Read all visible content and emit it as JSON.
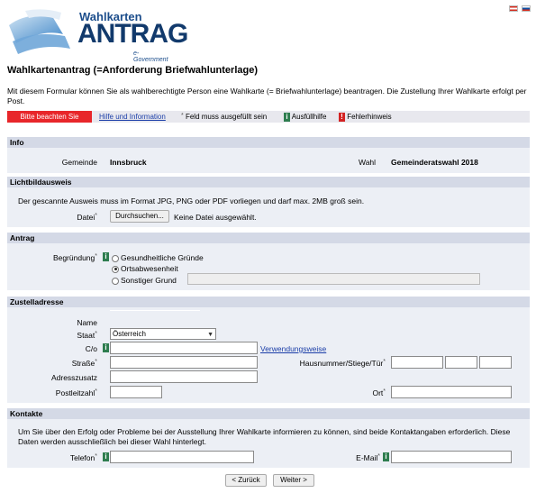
{
  "header": {
    "logo": {
      "line1": "Wahlkarten",
      "line2": "ANTRAG",
      "line3": "e-Government"
    },
    "languages": [
      {
        "name": "austria-flag"
      },
      {
        "name": "slovenia-flag"
      }
    ]
  },
  "page": {
    "title": "Wahlkartenantrag (=Anforderung Briefwahlunterlage)",
    "intro": "Mit diesem Formular können Sie als wahlberechtigte Person eine Wahlkarte (= Briefwahlunterlage) beantragen. Die Zustellung Ihrer Wahlkarte erfolgt per Post."
  },
  "helpbar": {
    "notice_button": "Bitte beachten Sie",
    "help_link": "Hilfe und Information",
    "required_legend": "Feld muss ausgefüllt sein",
    "fill_help_legend": "Ausfüllhilfe",
    "error_legend": "Fehlerhinweis",
    "required_mark": "*",
    "info_mark": "i",
    "error_mark": "!"
  },
  "info": {
    "heading": "Info",
    "gemeinde_label": "Gemeinde",
    "gemeinde_value": "Innsbruck",
    "wahl_label": "Wahl",
    "wahl_value": "Gemeinderatswahl 2018"
  },
  "photo_id": {
    "heading": "Lichtbildausweis",
    "description": "Der gescannte Ausweis muss im Format JPG, PNG oder PDF vorliegen und darf max. 2MB groß sein.",
    "file_label": "Datei",
    "browse_button": "Durchsuchen...",
    "no_file": "Keine Datei ausgewählt."
  },
  "application": {
    "heading": "Antrag",
    "reason_label": "Begründung",
    "options": [
      "Gesundheitliche Gründe",
      "Ortsabwesenheit",
      "Sonstiger Grund"
    ],
    "selected": "Ortsabwesenheit"
  },
  "delivery": {
    "heading": "Zustelladresse",
    "name_label": "Name",
    "country_label": "Staat",
    "country_value": "Österreich",
    "co_label": "C/o",
    "usage_link": "Verwendungsweise",
    "street_label": "Straße",
    "housenumber_label": "Hausnummer/Stiege/Tür",
    "address_extra_label": "Adresszusatz",
    "zip_label": "Postleitzahl",
    "city_label": "Ort"
  },
  "contacts": {
    "heading": "Kontakte",
    "description": "Um Sie über den Erfolg oder Probleme bei der Ausstellung Ihrer Wahlkarte informieren zu können, sind beide Kontaktangaben erforderlich. Diese Daten werden ausschließlich bei dieser Wahl hinterlegt.",
    "phone_label": "Telefon",
    "email_label": "E-Mail"
  },
  "nav": {
    "back_button": "< Zurück",
    "next_button": "Weiter >"
  },
  "colors": {
    "logo_blue": "#1d4e8c",
    "notice_red": "#e8262a",
    "section_header": "#d4d9e6",
    "section_body": "#eceff5",
    "info_green": "#2e7d4f",
    "error_red": "#d32222"
  }
}
